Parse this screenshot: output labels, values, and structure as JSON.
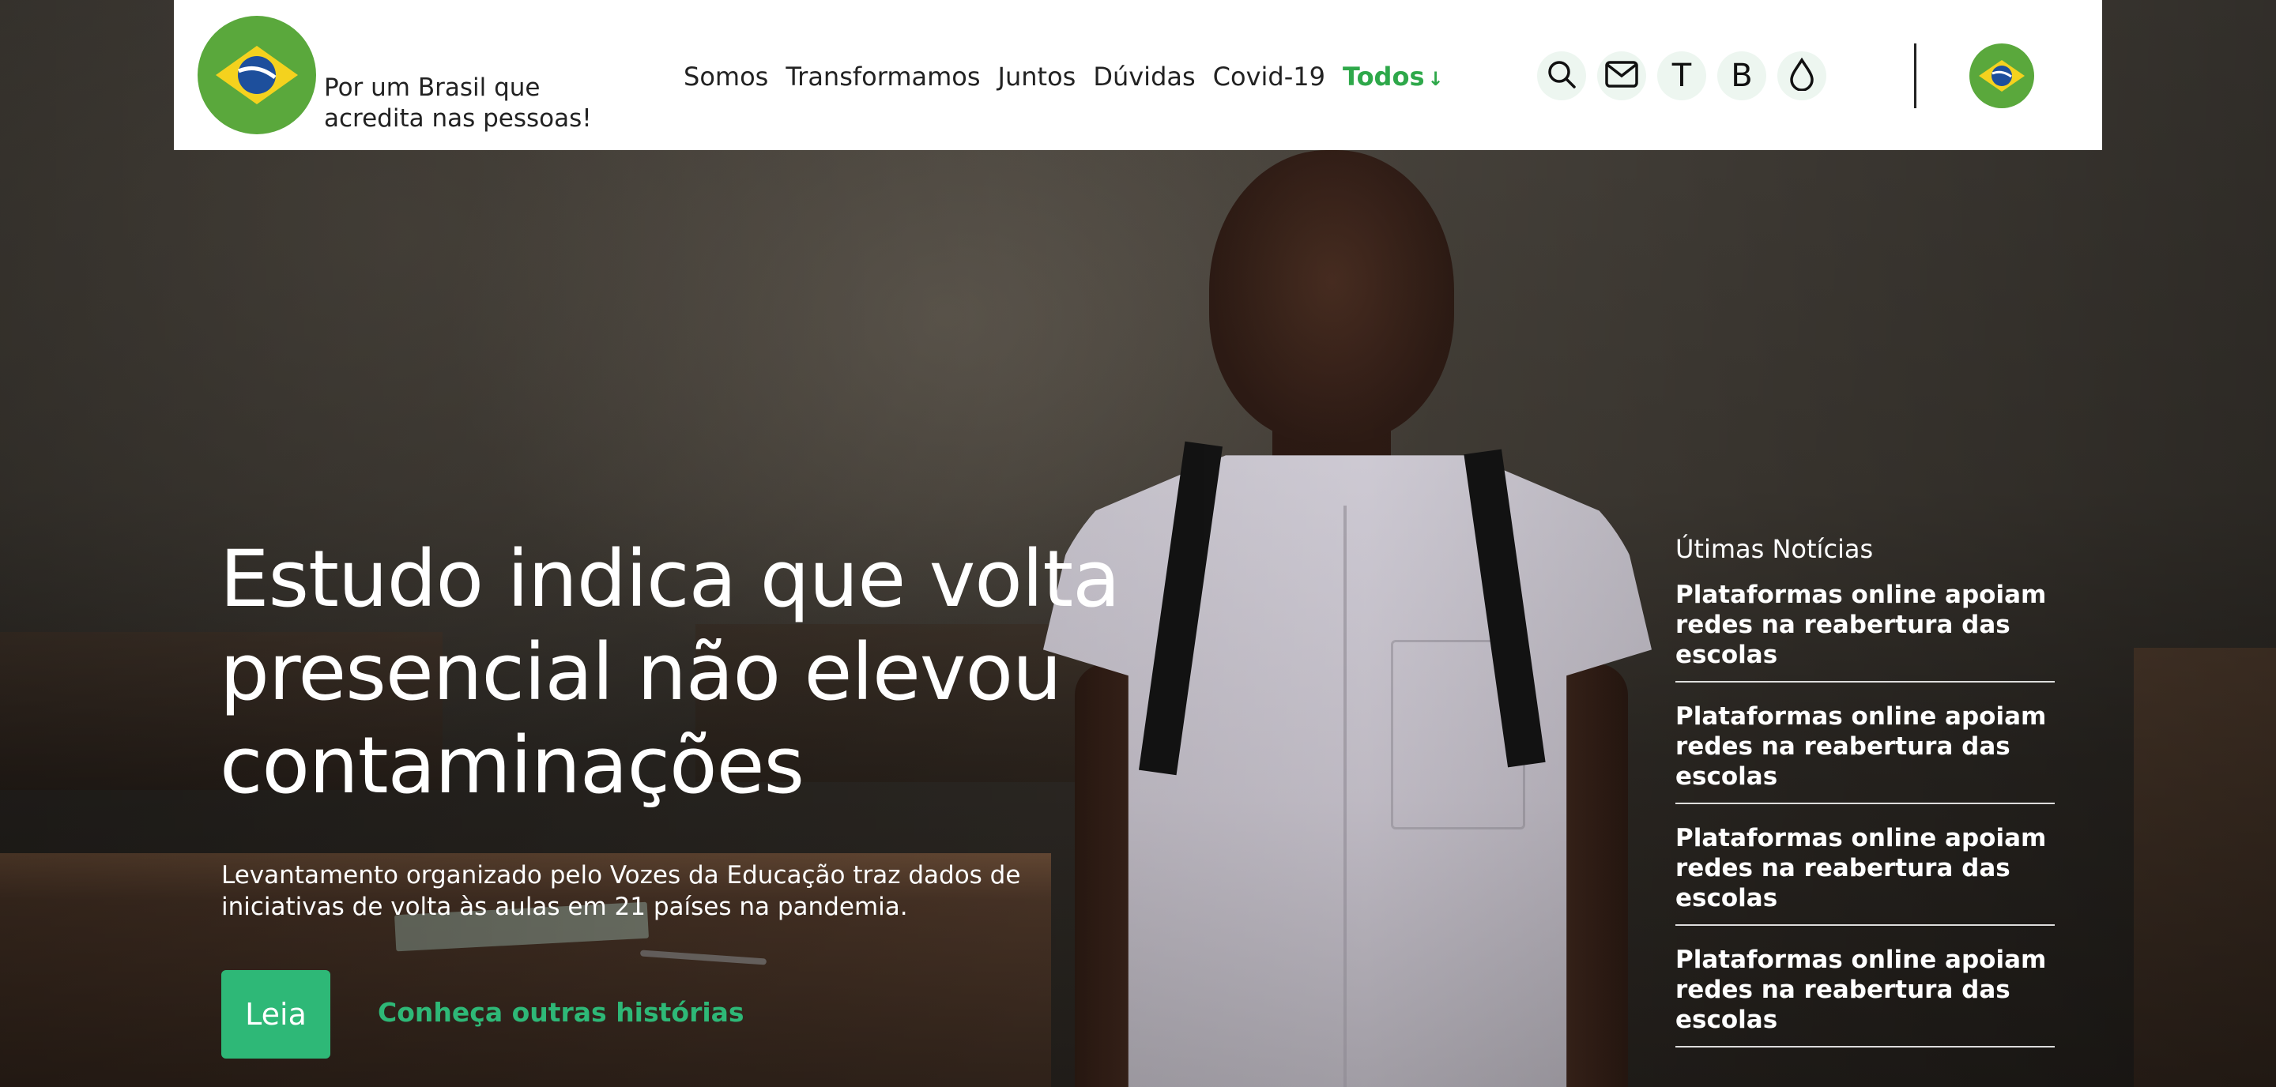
{
  "brand": {
    "tagline": "Por um Brasil que acredita nas pessoas!",
    "logo_icon": "brazil-flag-icon",
    "colors": {
      "green": "#5aa83c",
      "yellow": "#f4d21e",
      "blue": "#1d4f9c",
      "accent": "#2eb877"
    }
  },
  "nav": {
    "items": [
      {
        "label": "Somos"
      },
      {
        "label": "Transformamos"
      },
      {
        "label": "Juntos"
      },
      {
        "label": "Dúvidas"
      },
      {
        "label": "Covid-19"
      }
    ],
    "active": {
      "label": "Todos",
      "arrow": "↓"
    }
  },
  "toolbar": {
    "icons": [
      {
        "name": "search-icon",
        "glyph": ""
      },
      {
        "name": "mail-icon",
        "glyph": ""
      },
      {
        "name": "text-t-icon",
        "glyph": "T"
      },
      {
        "name": "text-b-icon",
        "glyph": "B"
      },
      {
        "name": "drop-icon",
        "glyph": ""
      }
    ],
    "language_icon": "brazil-flag-icon"
  },
  "hero": {
    "headline": "Estudo indica que volta presencial não elevou contaminações",
    "subtitle": "Levantamento organizado pelo Vozes da Educação traz dados de iniciativas de volta às aulas em 21 países na pandemia.",
    "read_button": "Leia",
    "more_link": "Conheça outras histórias"
  },
  "news": {
    "title": "Útimas Notícias",
    "items": [
      {
        "text": "Plataformas online apoiam redes na reabertura das escolas"
      },
      {
        "text": "Plataformas online apoiam redes na reabertura das escolas"
      },
      {
        "text": "Plataformas online apoiam redes na reabertura das escolas"
      },
      {
        "text": "Plataformas online apoiam redes na reabertura das escolas"
      }
    ]
  }
}
